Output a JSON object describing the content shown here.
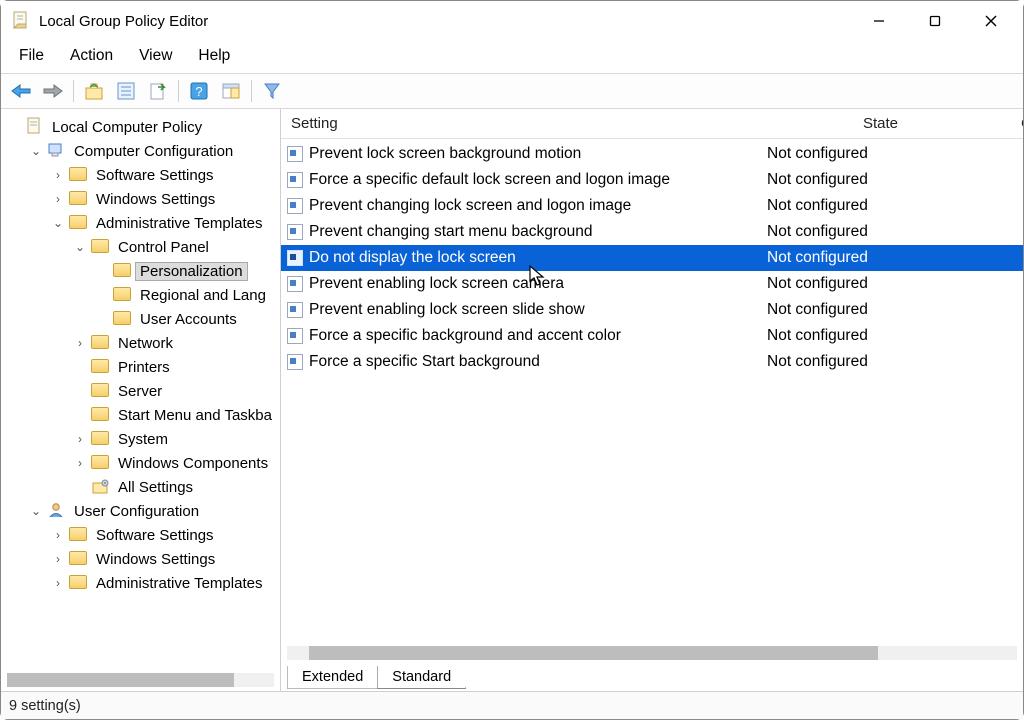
{
  "window": {
    "title": "Local Group Policy Editor"
  },
  "menubar": [
    "File",
    "Action",
    "View",
    "Help"
  ],
  "columns": {
    "setting": "Setting",
    "state": "State",
    "comment": "Cor"
  },
  "tree": [
    {
      "depth": 0,
      "exp": "",
      "icon": "doc",
      "label": "Local Computer Policy"
    },
    {
      "depth": 1,
      "exp": "v",
      "icon": "pc",
      "label": "Computer Configuration"
    },
    {
      "depth": 2,
      "exp": ">",
      "icon": "folder",
      "label": "Software Settings"
    },
    {
      "depth": 2,
      "exp": ">",
      "icon": "folder",
      "label": "Windows Settings"
    },
    {
      "depth": 2,
      "exp": "v",
      "icon": "folder",
      "label": "Administrative Templates"
    },
    {
      "depth": 3,
      "exp": "v",
      "icon": "folder",
      "label": "Control Panel"
    },
    {
      "depth": 4,
      "exp": "",
      "icon": "folder",
      "label": "Personalization",
      "selected": true
    },
    {
      "depth": 4,
      "exp": "",
      "icon": "folder",
      "label": "Regional and Lang"
    },
    {
      "depth": 4,
      "exp": "",
      "icon": "folder",
      "label": "User Accounts"
    },
    {
      "depth": 3,
      "exp": ">",
      "icon": "folder",
      "label": "Network"
    },
    {
      "depth": 3,
      "exp": "",
      "icon": "folder",
      "label": "Printers"
    },
    {
      "depth": 3,
      "exp": "",
      "icon": "folder",
      "label": "Server"
    },
    {
      "depth": 3,
      "exp": "",
      "icon": "folder",
      "label": "Start Menu and Taskba"
    },
    {
      "depth": 3,
      "exp": ">",
      "icon": "folder",
      "label": "System"
    },
    {
      "depth": 3,
      "exp": ">",
      "icon": "folder",
      "label": "Windows Components"
    },
    {
      "depth": 3,
      "exp": "",
      "icon": "settings",
      "label": "All Settings"
    },
    {
      "depth": 1,
      "exp": "v",
      "icon": "user",
      "label": "User Configuration"
    },
    {
      "depth": 2,
      "exp": ">",
      "icon": "folder",
      "label": "Software Settings"
    },
    {
      "depth": 2,
      "exp": ">",
      "icon": "folder",
      "label": "Windows Settings"
    },
    {
      "depth": 2,
      "exp": ">",
      "icon": "folder",
      "label": "Administrative Templates"
    }
  ],
  "items": [
    {
      "name": "Prevent lock screen background motion",
      "state": "Not configured"
    },
    {
      "name": "Force a specific default lock screen and logon image",
      "state": "Not configured"
    },
    {
      "name": "Prevent changing lock screen and logon image",
      "state": "Not configured"
    },
    {
      "name": "Prevent changing start menu background",
      "state": "Not configured"
    },
    {
      "name": "Do not display the lock screen",
      "state": "Not configured",
      "selected": true
    },
    {
      "name": "Prevent enabling lock screen camera",
      "state": "Not configured"
    },
    {
      "name": "Prevent enabling lock screen slide show",
      "state": "Not configured"
    },
    {
      "name": "Force a specific background and accent color",
      "state": "Not configured"
    },
    {
      "name": "Force a specific Start background",
      "state": "Not configured"
    }
  ],
  "tabs": {
    "extended": "Extended",
    "standard": "Standard"
  },
  "status": "9 setting(s)"
}
